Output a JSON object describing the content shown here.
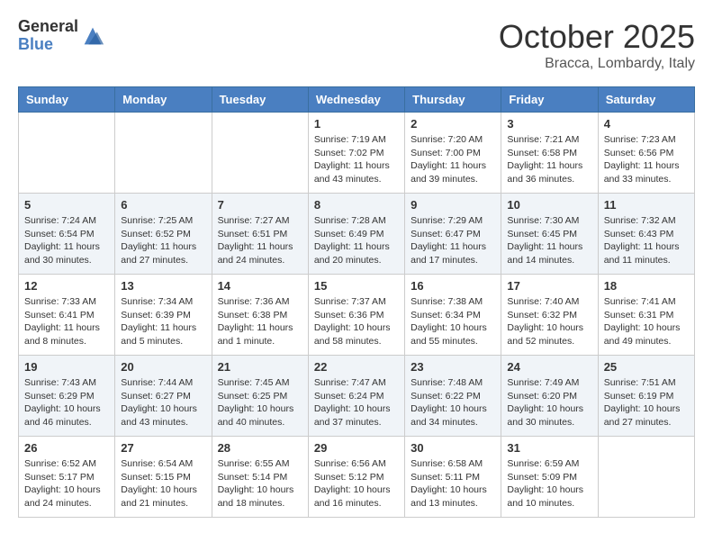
{
  "logo": {
    "general": "General",
    "blue": "Blue"
  },
  "title": "October 2025",
  "subtitle": "Bracca, Lombardy, Italy",
  "days_of_week": [
    "Sunday",
    "Monday",
    "Tuesday",
    "Wednesday",
    "Thursday",
    "Friday",
    "Saturday"
  ],
  "weeks": [
    [
      {
        "day": "",
        "info": ""
      },
      {
        "day": "",
        "info": ""
      },
      {
        "day": "",
        "info": ""
      },
      {
        "day": "1",
        "info": "Sunrise: 7:19 AM\nSunset: 7:02 PM\nDaylight: 11 hours and 43 minutes."
      },
      {
        "day": "2",
        "info": "Sunrise: 7:20 AM\nSunset: 7:00 PM\nDaylight: 11 hours and 39 minutes."
      },
      {
        "day": "3",
        "info": "Sunrise: 7:21 AM\nSunset: 6:58 PM\nDaylight: 11 hours and 36 minutes."
      },
      {
        "day": "4",
        "info": "Sunrise: 7:23 AM\nSunset: 6:56 PM\nDaylight: 11 hours and 33 minutes."
      }
    ],
    [
      {
        "day": "5",
        "info": "Sunrise: 7:24 AM\nSunset: 6:54 PM\nDaylight: 11 hours and 30 minutes."
      },
      {
        "day": "6",
        "info": "Sunrise: 7:25 AM\nSunset: 6:52 PM\nDaylight: 11 hours and 27 minutes."
      },
      {
        "day": "7",
        "info": "Sunrise: 7:27 AM\nSunset: 6:51 PM\nDaylight: 11 hours and 24 minutes."
      },
      {
        "day": "8",
        "info": "Sunrise: 7:28 AM\nSunset: 6:49 PM\nDaylight: 11 hours and 20 minutes."
      },
      {
        "day": "9",
        "info": "Sunrise: 7:29 AM\nSunset: 6:47 PM\nDaylight: 11 hours and 17 minutes."
      },
      {
        "day": "10",
        "info": "Sunrise: 7:30 AM\nSunset: 6:45 PM\nDaylight: 11 hours and 14 minutes."
      },
      {
        "day": "11",
        "info": "Sunrise: 7:32 AM\nSunset: 6:43 PM\nDaylight: 11 hours and 11 minutes."
      }
    ],
    [
      {
        "day": "12",
        "info": "Sunrise: 7:33 AM\nSunset: 6:41 PM\nDaylight: 11 hours and 8 minutes."
      },
      {
        "day": "13",
        "info": "Sunrise: 7:34 AM\nSunset: 6:39 PM\nDaylight: 11 hours and 5 minutes."
      },
      {
        "day": "14",
        "info": "Sunrise: 7:36 AM\nSunset: 6:38 PM\nDaylight: 11 hours and 1 minute."
      },
      {
        "day": "15",
        "info": "Sunrise: 7:37 AM\nSunset: 6:36 PM\nDaylight: 10 hours and 58 minutes."
      },
      {
        "day": "16",
        "info": "Sunrise: 7:38 AM\nSunset: 6:34 PM\nDaylight: 10 hours and 55 minutes."
      },
      {
        "day": "17",
        "info": "Sunrise: 7:40 AM\nSunset: 6:32 PM\nDaylight: 10 hours and 52 minutes."
      },
      {
        "day": "18",
        "info": "Sunrise: 7:41 AM\nSunset: 6:31 PM\nDaylight: 10 hours and 49 minutes."
      }
    ],
    [
      {
        "day": "19",
        "info": "Sunrise: 7:43 AM\nSunset: 6:29 PM\nDaylight: 10 hours and 46 minutes."
      },
      {
        "day": "20",
        "info": "Sunrise: 7:44 AM\nSunset: 6:27 PM\nDaylight: 10 hours and 43 minutes."
      },
      {
        "day": "21",
        "info": "Sunrise: 7:45 AM\nSunset: 6:25 PM\nDaylight: 10 hours and 40 minutes."
      },
      {
        "day": "22",
        "info": "Sunrise: 7:47 AM\nSunset: 6:24 PM\nDaylight: 10 hours and 37 minutes."
      },
      {
        "day": "23",
        "info": "Sunrise: 7:48 AM\nSunset: 6:22 PM\nDaylight: 10 hours and 34 minutes."
      },
      {
        "day": "24",
        "info": "Sunrise: 7:49 AM\nSunset: 6:20 PM\nDaylight: 10 hours and 30 minutes."
      },
      {
        "day": "25",
        "info": "Sunrise: 7:51 AM\nSunset: 6:19 PM\nDaylight: 10 hours and 27 minutes."
      }
    ],
    [
      {
        "day": "26",
        "info": "Sunrise: 6:52 AM\nSunset: 5:17 PM\nDaylight: 10 hours and 24 minutes."
      },
      {
        "day": "27",
        "info": "Sunrise: 6:54 AM\nSunset: 5:15 PM\nDaylight: 10 hours and 21 minutes."
      },
      {
        "day": "28",
        "info": "Sunrise: 6:55 AM\nSunset: 5:14 PM\nDaylight: 10 hours and 18 minutes."
      },
      {
        "day": "29",
        "info": "Sunrise: 6:56 AM\nSunset: 5:12 PM\nDaylight: 10 hours and 16 minutes."
      },
      {
        "day": "30",
        "info": "Sunrise: 6:58 AM\nSunset: 5:11 PM\nDaylight: 10 hours and 13 minutes."
      },
      {
        "day": "31",
        "info": "Sunrise: 6:59 AM\nSunset: 5:09 PM\nDaylight: 10 hours and 10 minutes."
      },
      {
        "day": "",
        "info": ""
      }
    ]
  ]
}
